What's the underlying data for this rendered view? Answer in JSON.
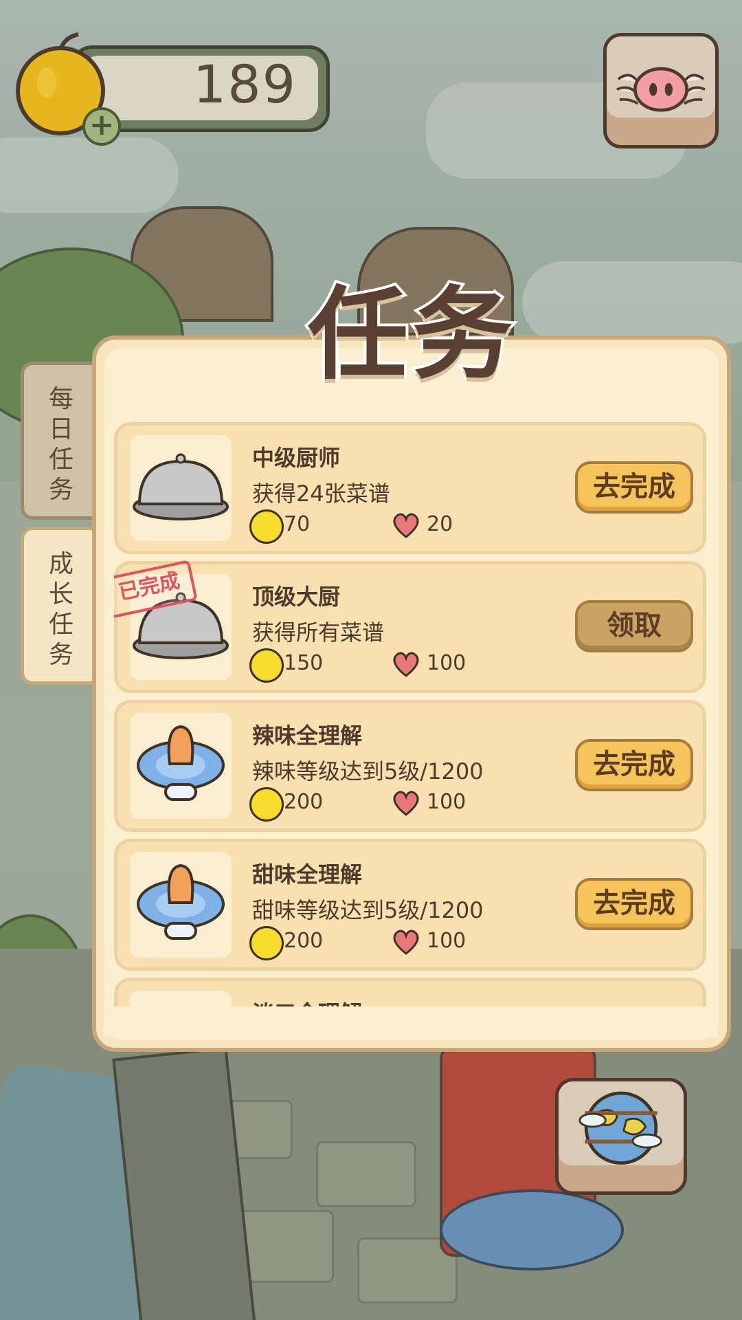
{
  "currency": {
    "amount": "189",
    "add_label": "+"
  },
  "title": "任务",
  "tabs": {
    "daily": "每日任务",
    "growth": "成长任务"
  },
  "colors": {
    "coin": "#f8dc2e",
    "heart": "#e8787a",
    "button": "#f7c45c",
    "claim_button": "#c9a363",
    "stamp": "#e0525d"
  },
  "tasks": [
    {
      "icon": "cloche-icon",
      "name": "中级厨师",
      "desc": "获得24张菜谱",
      "coins": "70",
      "hearts": "20",
      "button": "去完成",
      "completed": false
    },
    {
      "icon": "cloche-icon",
      "name": "顶级大厨",
      "desc": "获得所有菜谱",
      "coins": "150",
      "hearts": "100",
      "button": "领取",
      "completed": true,
      "stamp": "已完成"
    },
    {
      "icon": "pacifier-icon",
      "name": "辣味全理解",
      "desc": "辣味等级达到5级/1200",
      "coins": "200",
      "hearts": "100",
      "button": "去完成",
      "completed": false
    },
    {
      "icon": "pacifier-icon",
      "name": "甜味全理解",
      "desc": "甜味等级达到5级/1200",
      "coins": "200",
      "hearts": "100",
      "button": "去完成",
      "completed": false
    },
    {
      "icon": "cloche-icon",
      "name": "淡口全理解",
      "desc": "",
      "coins": "",
      "hearts": "",
      "button": "",
      "completed": false
    }
  ]
}
